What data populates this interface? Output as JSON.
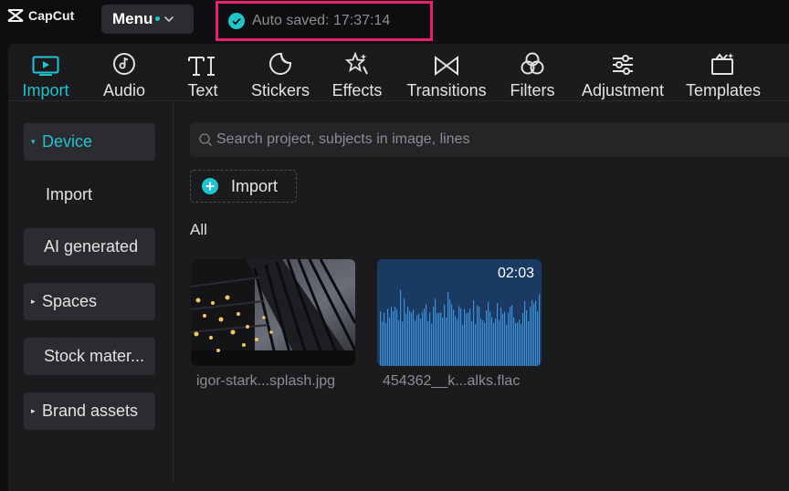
{
  "app": {
    "name": "CapCut"
  },
  "header": {
    "menu_label": "Menu",
    "autosave_text": "Auto saved: 17:37:14"
  },
  "toolbar": {
    "tabs": [
      {
        "label": "Import",
        "icon": "import-icon",
        "active": true
      },
      {
        "label": "Audio",
        "icon": "audio-icon"
      },
      {
        "label": "Text",
        "icon": "text-icon"
      },
      {
        "label": "Stickers",
        "icon": "stickers-icon"
      },
      {
        "label": "Effects",
        "icon": "effects-icon"
      },
      {
        "label": "Transitions",
        "icon": "transitions-icon"
      },
      {
        "label": "Filters",
        "icon": "filters-icon"
      },
      {
        "label": "Adjustment",
        "icon": "adjustment-icon"
      },
      {
        "label": "Templates",
        "icon": "templates-icon"
      }
    ]
  },
  "sidebar": {
    "items": [
      {
        "label": "Device",
        "expanded": true,
        "active": true
      },
      {
        "label": "Import"
      },
      {
        "label": "AI generated"
      },
      {
        "label": "Spaces",
        "expandable": true
      },
      {
        "label": "Stock mater..."
      },
      {
        "label": "Brand assets",
        "expandable": true
      }
    ]
  },
  "main": {
    "search_placeholder": "Search project, subjects in image, lines",
    "import_label": "Import",
    "filter_label": "All",
    "media": [
      {
        "name": "igor-stark...splash.jpg",
        "type": "image"
      },
      {
        "name": "454362__k...alks.flac",
        "type": "audio",
        "duration": "02:03"
      }
    ]
  },
  "colors": {
    "accent": "#22c3d1",
    "highlight_border": "#e8216a",
    "panel_bg": "#1b1b1e",
    "audio_card_bg": "#1a3a63"
  }
}
